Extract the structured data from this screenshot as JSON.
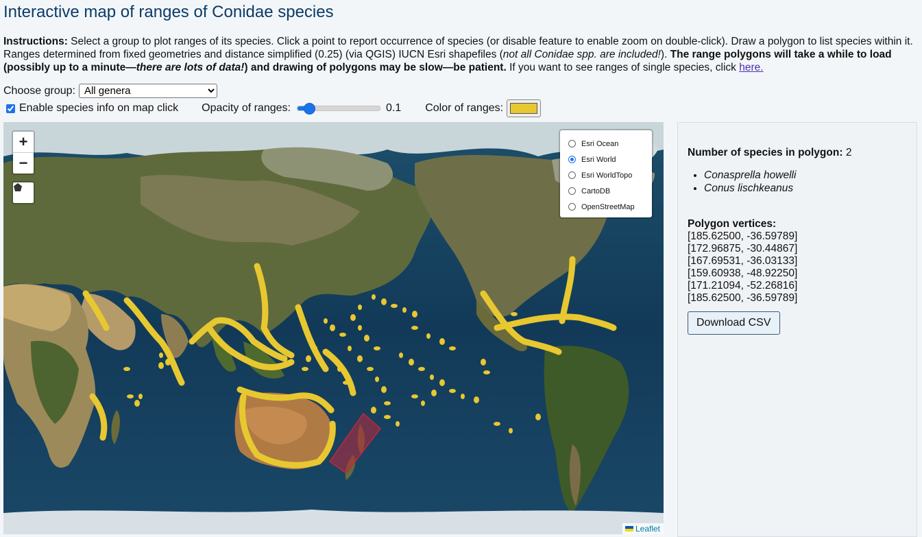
{
  "title": "Interactive map of ranges of Conidae species",
  "instructions": {
    "p1_bold": "Instructions:",
    "p1": " Select a group to plot ranges of its species. Click a point to report occurrence of species (or disable feature to enable zoom on double-click). Draw a polygon to list species within it. Ranges determined from fixed geometries and distance simplified (0.25) (via QGIS) IUCN Esri shapefiles (",
    "p2_italic": "not all Conidae spp. are included!",
    "p3": "). ",
    "p4_bold": "The range polygons will take a while to load (possibly up to a minute—",
    "p5_bolditalic": "there are lots of data!",
    "p6_bold": ") and drawing of polygons may be slow—be patient.",
    "p7": " If you want to see ranges of single species, click ",
    "link": "here."
  },
  "controls": {
    "group_label": "Choose group:",
    "group_selected": "All genera",
    "enable_info_label": "Enable species info on map click",
    "enable_info_checked": true,
    "opacity_label": "Opacity of ranges:",
    "opacity_value": "0.1",
    "opacity_fraction": 0.1,
    "color_label": "Color of ranges:",
    "range_color": "#e8c830"
  },
  "map": {
    "zoom_in": "+",
    "zoom_out": "−",
    "draw_icon": "polygon-draw-icon",
    "layers": [
      {
        "label": "Esri Ocean",
        "selected": false
      },
      {
        "label": "Esri World",
        "selected": true
      },
      {
        "label": "Esri WorldTopo",
        "selected": false
      },
      {
        "label": "CartoDB",
        "selected": false
      },
      {
        "label": "OpenStreetMap",
        "selected": false
      }
    ],
    "attribution": "Leaflet",
    "selection_color": "#c0283a"
  },
  "results": {
    "count_label": "Number of species in polygon:",
    "count_value": "2",
    "species": [
      "Conasprella howelli",
      "Conus lischkeanus"
    ],
    "vertices_label": "Polygon vertices:",
    "vertices": [
      "[185.62500, -36.59789]",
      "[172.96875, -30.44867]",
      "[167.69531, -36.03133]",
      "[159.60938, -48.92250]",
      "[171.21094, -52.26816]",
      "[185.62500, -36.59789]"
    ],
    "download_label": "Download CSV"
  }
}
